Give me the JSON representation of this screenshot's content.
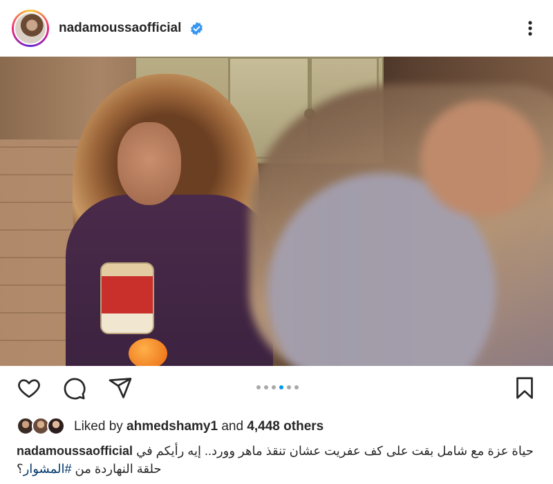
{
  "post": {
    "username": "nadamoussaofficial",
    "verified": true,
    "colors": {
      "link": "#00376b",
      "carousel_active": "#0095f6",
      "verified": "#3897f0"
    }
  },
  "actions": {
    "icons": [
      "heart-icon",
      "comment-icon",
      "share-icon",
      "bookmark-icon"
    ],
    "carousel": {
      "count": 6,
      "active_index": 3
    }
  },
  "likes": {
    "prefix": "Liked by ",
    "user": "ahmedshamy1",
    "middle": " and ",
    "others": "4,448 others"
  },
  "caption": {
    "username": "nadamoussaofficial",
    "line1": "حياة عزة مع شامل بقت على كف عفريت عشان تنقذ ماهر وورد.. إيه رأيكم في",
    "line2_text": "حلقة النهاردة من ",
    "hashtag": "#المشوار",
    "line2_end": "؟"
  }
}
